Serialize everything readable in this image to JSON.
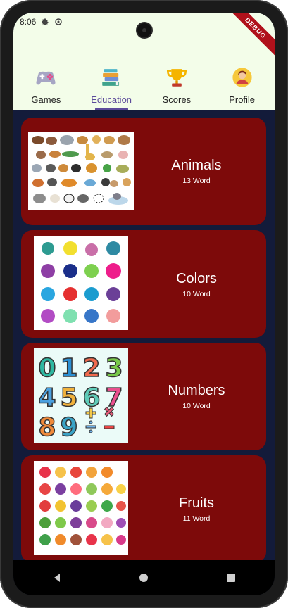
{
  "status": {
    "time": "8:06",
    "icons": [
      "gear-icon",
      "sync-icon"
    ],
    "debug_banner": "DEBUG"
  },
  "tabs": [
    {
      "label": "Games",
      "icon": "gamepad-icon"
    },
    {
      "label": "Education",
      "icon": "books-icon"
    },
    {
      "label": "Scores",
      "icon": "trophy-icon"
    },
    {
      "label": "Profile",
      "icon": "user-profile-icon"
    }
  ],
  "active_tab": "Education",
  "categories": [
    {
      "title": "Animals",
      "count_text": "13  Word",
      "image": "animals-illustration"
    },
    {
      "title": "Colors",
      "count_text": "10  Word",
      "image": "color-splashes-illustration"
    },
    {
      "title": "Numbers",
      "count_text": "10  Word",
      "image": "numbers-illustration"
    },
    {
      "title": "Fruits",
      "count_text": "11  Word",
      "image": "fruits-illustration"
    }
  ],
  "navbar": [
    "back-icon",
    "home-icon",
    "recents-icon"
  ],
  "colors": {
    "card": "#7d0a0a",
    "background": "#131b3a",
    "header": "#f3fde9",
    "accent": "#5c4b9b"
  }
}
